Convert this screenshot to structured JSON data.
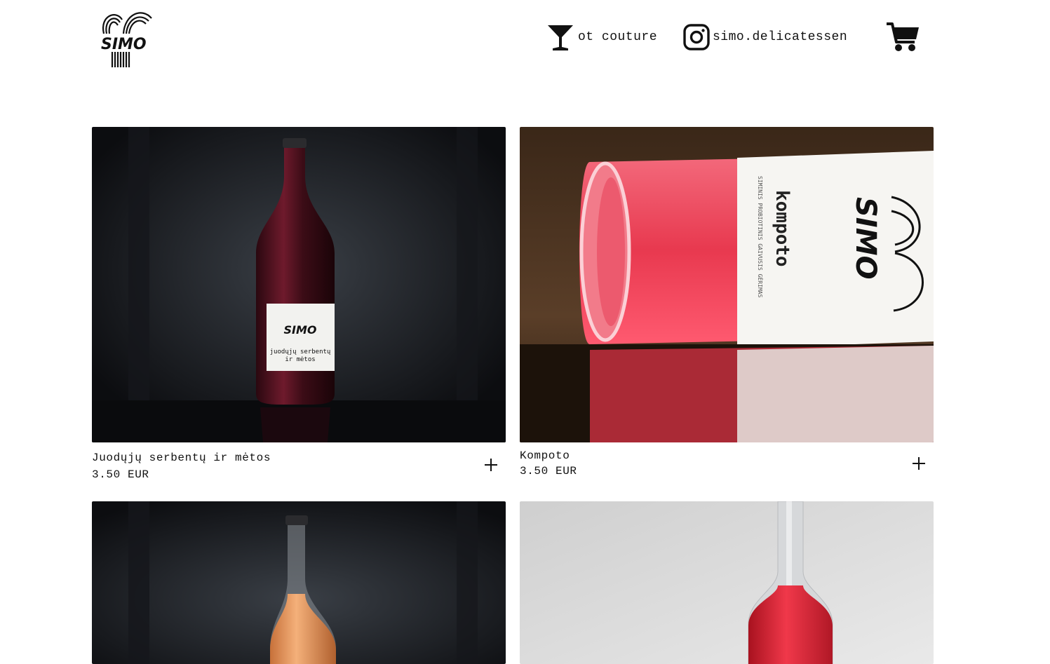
{
  "header": {
    "logo_text": "SIMO",
    "nav": [
      {
        "label": "ot couture",
        "icon": "cocktail-glass-icon"
      },
      {
        "label": "simo.delicatessen",
        "icon": "instagram-icon"
      }
    ],
    "cart_icon": "shopping-cart-icon"
  },
  "products": [
    {
      "name": "Juodųjų serbentų ir mėtos",
      "price": "3.50 EUR",
      "bottle_label": "juodųjų serbentų ir mėtos",
      "liquid_color": "#5a1424"
    },
    {
      "name": "Kompoto",
      "price": "3.50 EUR",
      "bottle_label": "kompoto",
      "label_sub": "SIMINIS PROBIOTINIS GAIVUSIS GĖRIMAS",
      "liquid_color": "#e8394f"
    },
    {
      "liquid_color": "#f0a060"
    },
    {
      "liquid_color": "#e12a3b"
    }
  ],
  "colors": {
    "text": "#111111",
    "background": "#ffffff"
  }
}
